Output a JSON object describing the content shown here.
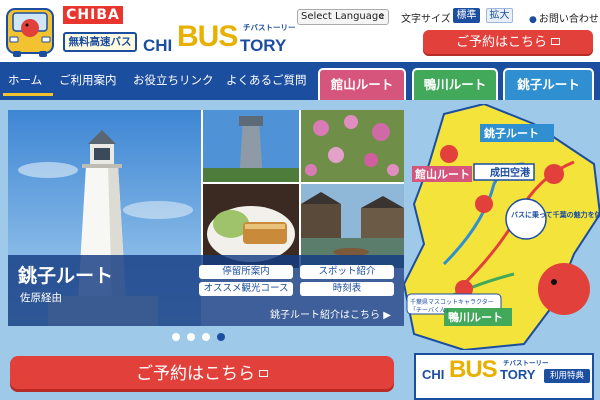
{
  "header": {
    "logo_chiba": "CHIBA",
    "logo_free": "無料高速バス",
    "logo_title_chi": "CHI",
    "logo_title_bus": "BUS",
    "logo_title_tory": "TORY",
    "logo_title_kana": "チバストーリー",
    "language_select": "Select Language",
    "font_size_label": "文字サイズ",
    "font_size_normal": "標準",
    "font_size_large": "拡大",
    "contact": "お問い合わせ",
    "reserve_button": "ご予約はこちら"
  },
  "nav": {
    "items": [
      {
        "label": "ホーム"
      },
      {
        "label": "ご利用案内"
      },
      {
        "label": "お役立ちリンク"
      },
      {
        "label": "よくあるご質問"
      }
    ]
  },
  "route_tabs": [
    {
      "label": "館山ルート",
      "color": "#d5557d"
    },
    {
      "label": "鴨川ルート",
      "color": "#42a85a"
    },
    {
      "label": "銚子ルート",
      "color": "#2f8fd0"
    }
  ],
  "slider": {
    "title": "銚子ルート",
    "subtitle": "佐原経由",
    "buttons": [
      {
        "label": "停留所案内"
      },
      {
        "label": "スポット紹介"
      },
      {
        "label": "オススメ観光コース"
      },
      {
        "label": "時刻表"
      }
    ],
    "more_link": "銚子ルート紹介はこちら",
    "pagination": {
      "total": 4,
      "active": 4
    }
  },
  "map": {
    "label_choshi": "銚子ルート",
    "label_narita": "成田空港",
    "label_tateyama": "館山ルート",
    "label_kamogawa": "鴨川ルート",
    "speech": "バスに乗って千葉の魅力を体験してね。",
    "mascot_caption_1": "千葉県マスコットキャラクター",
    "mascot_caption_2": "「チーバくん」"
  },
  "main": {
    "reserve_button": "ご予約はこちら"
  },
  "banner": {
    "chi": "CHI",
    "bus": "BUS",
    "tory": "TORY",
    "kana": "チバストーリー",
    "benefit": "利用特典"
  },
  "colors": {
    "primary_blue": "#1c4ea0",
    "reserve_red": "#e2403a",
    "accent_yellow": "#f2c230"
  }
}
